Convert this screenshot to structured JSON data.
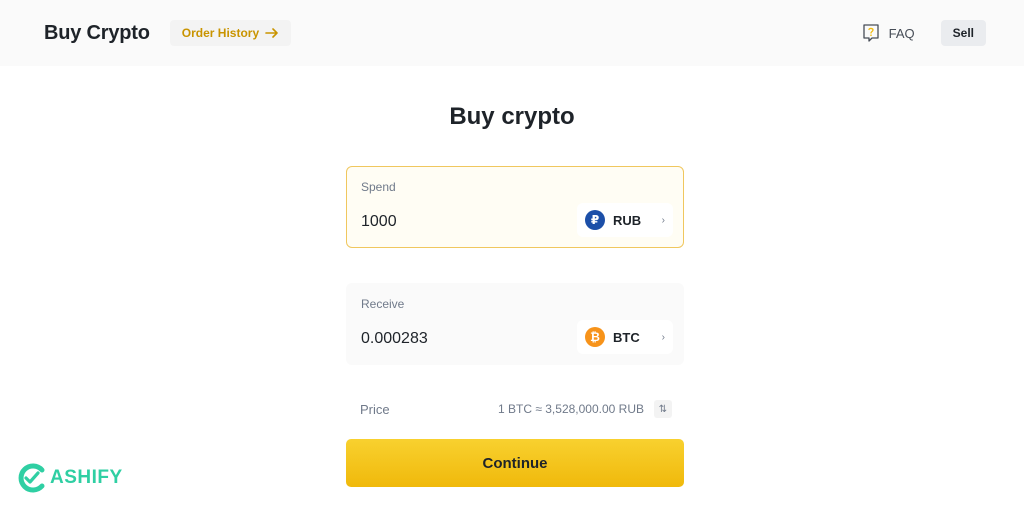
{
  "header": {
    "title": "Buy Crypto",
    "order_history_label": "Order History",
    "faq_label": "FAQ",
    "sell_label": "Sell"
  },
  "main": {
    "title": "Buy crypto",
    "spend": {
      "label": "Spend",
      "value": "1000",
      "currency_code": "RUB",
      "currency_symbol": "₽"
    },
    "receive": {
      "label": "Receive",
      "value": "0.000283",
      "currency_code": "BTC",
      "currency_symbol": "₿"
    },
    "price": {
      "label": "Price",
      "value": "1 BTC ≈ 3,528,000.00 RUB"
    },
    "continue_label": "Continue"
  },
  "watermark": {
    "text": "ASHIFY"
  },
  "colors": {
    "accent_yellow": "#f0b90b",
    "order_history_text": "#c99400",
    "rub_coin": "#1c4fa8",
    "btc_coin": "#f7931a",
    "watermark_green": "#2fcfa3"
  },
  "icons": {
    "order_history": "arrow-right-icon",
    "faq": "help-question-icon",
    "swap": "swap-arrows-icon",
    "dropdown": "chevron-right-icon"
  }
}
